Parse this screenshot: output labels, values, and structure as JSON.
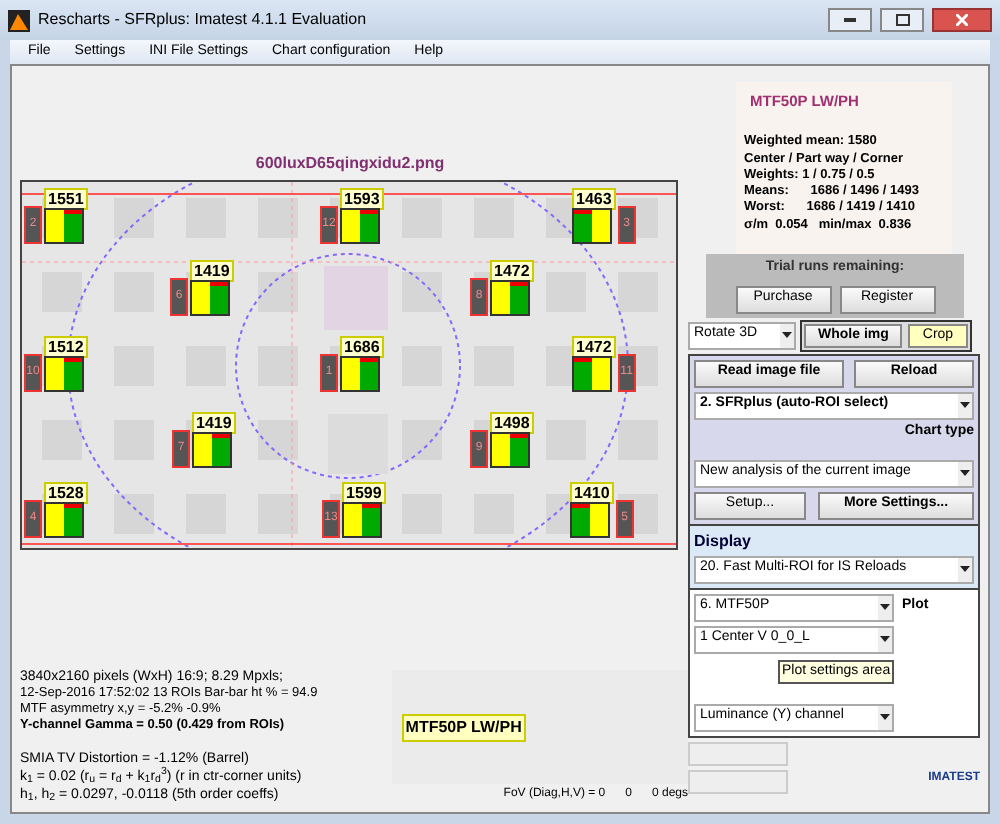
{
  "window": {
    "title": "Rescharts - SFRplus:  Imatest 4.1.1  Evaluation"
  },
  "menu": [
    "File",
    "Settings",
    "INI File Settings",
    "Chart configuration",
    "Help"
  ],
  "image": {
    "filename": "600luxD65qingxidu2.png",
    "markers": [
      {
        "value": "1551",
        "roi": "2",
        "kind": "left"
      },
      {
        "value": "1593",
        "roi": "12",
        "kind": "left"
      },
      {
        "value": "1463",
        "roi": "3",
        "kind": "right"
      },
      {
        "value": "1419",
        "roi": "6",
        "kind": "left"
      },
      {
        "value": "1472",
        "roi": "8",
        "kind": "left"
      },
      {
        "value": "1512",
        "roi": "10",
        "kind": "left"
      },
      {
        "value": "1686",
        "roi": "1",
        "kind": "left"
      },
      {
        "value": "1472",
        "roi": "11",
        "kind": "right"
      },
      {
        "value": "1419",
        "roi": "7",
        "kind": "left"
      },
      {
        "value": "1498",
        "roi": "9",
        "kind": "left"
      },
      {
        "value": "1528",
        "roi": "4",
        "kind": "left"
      },
      {
        "value": "1599",
        "roi": "13",
        "kind": "left"
      },
      {
        "value": "1410",
        "roi": "5",
        "kind": "right"
      }
    ]
  },
  "info": {
    "lines": [
      {
        "text": "3840x2160 pixels (WxH) 16:9;  8.29 Mpxls;",
        "kind": "main"
      },
      {
        "text": "12-Sep-2016 17:52:02   13 ROIs   Bar-bar ht % = 94.9",
        "kind": "small"
      },
      {
        "text": "MTF asymmetry x,y = -5.2%  -0.9%",
        "kind": "small"
      },
      {
        "text": "**Y-channel    Gamma = 0.50  (0.429 from ROIs)**",
        "kind": "small"
      }
    ],
    "distortion": [
      "SMIA TV Distortion = -1.12%  (Barrel)",
      "k$_{1}$ = 0.02  (r$_{u}$ = r$_{d}$ + k$_{1}$r$_{d}$$^{3}$)  (r in ctr-corner units)",
      "h$_{1}$, h$_{2}$ = 0.0297,  -0.0118  (5th order coeffs)"
    ],
    "plot_label": "MTF50P LW/PH",
    "fov": [
      "FoV (Diag,H,V) = 0",
      "0",
      "0 degs"
    ]
  },
  "results": {
    "title": "MTF50P LW/PH",
    "lines": [
      "Weighted mean: 1580",
      "Center / Part way / Corner",
      "Weights: 1 / 0.75 / 0.5",
      "Means:      1686 / 1496 / 1493",
      "Worst:      1686 / 1419 / 1410",
      "σ/m  0.054   min/max  0.836"
    ]
  },
  "trial": {
    "title": "Trial runs remaining:",
    "buttons": [
      "Purchase",
      "Register"
    ]
  },
  "view": {
    "rotate": "Rotate 3D",
    "buttons": [
      {
        "label": "Whole img",
        "selected": true
      },
      {
        "label": "Crop",
        "selected": false
      }
    ]
  },
  "controls": {
    "read": "Read image file",
    "reload": "Reload",
    "chart_select": "2. SFRplus (auto-ROI select)",
    "chart_type_label": "Chart type",
    "analysis_select": "New analysis of the current image",
    "setup": "Setup...",
    "more": "More Settings..."
  },
  "display": {
    "title": "Display",
    "select": "20. Fast Multi-ROI for IS Reloads",
    "plot_select": "6.  MTF50P",
    "plot_label": "Plot",
    "region_select": "1  Center  V     0_0_L",
    "tooltip": "Plot settings area",
    "channel_select": "Luminance (Y) channel"
  },
  "bottom_buttons": [
    {
      "disabled": true
    },
    {
      "disabled": true
    }
  ],
  "logo": "IMATEST"
}
